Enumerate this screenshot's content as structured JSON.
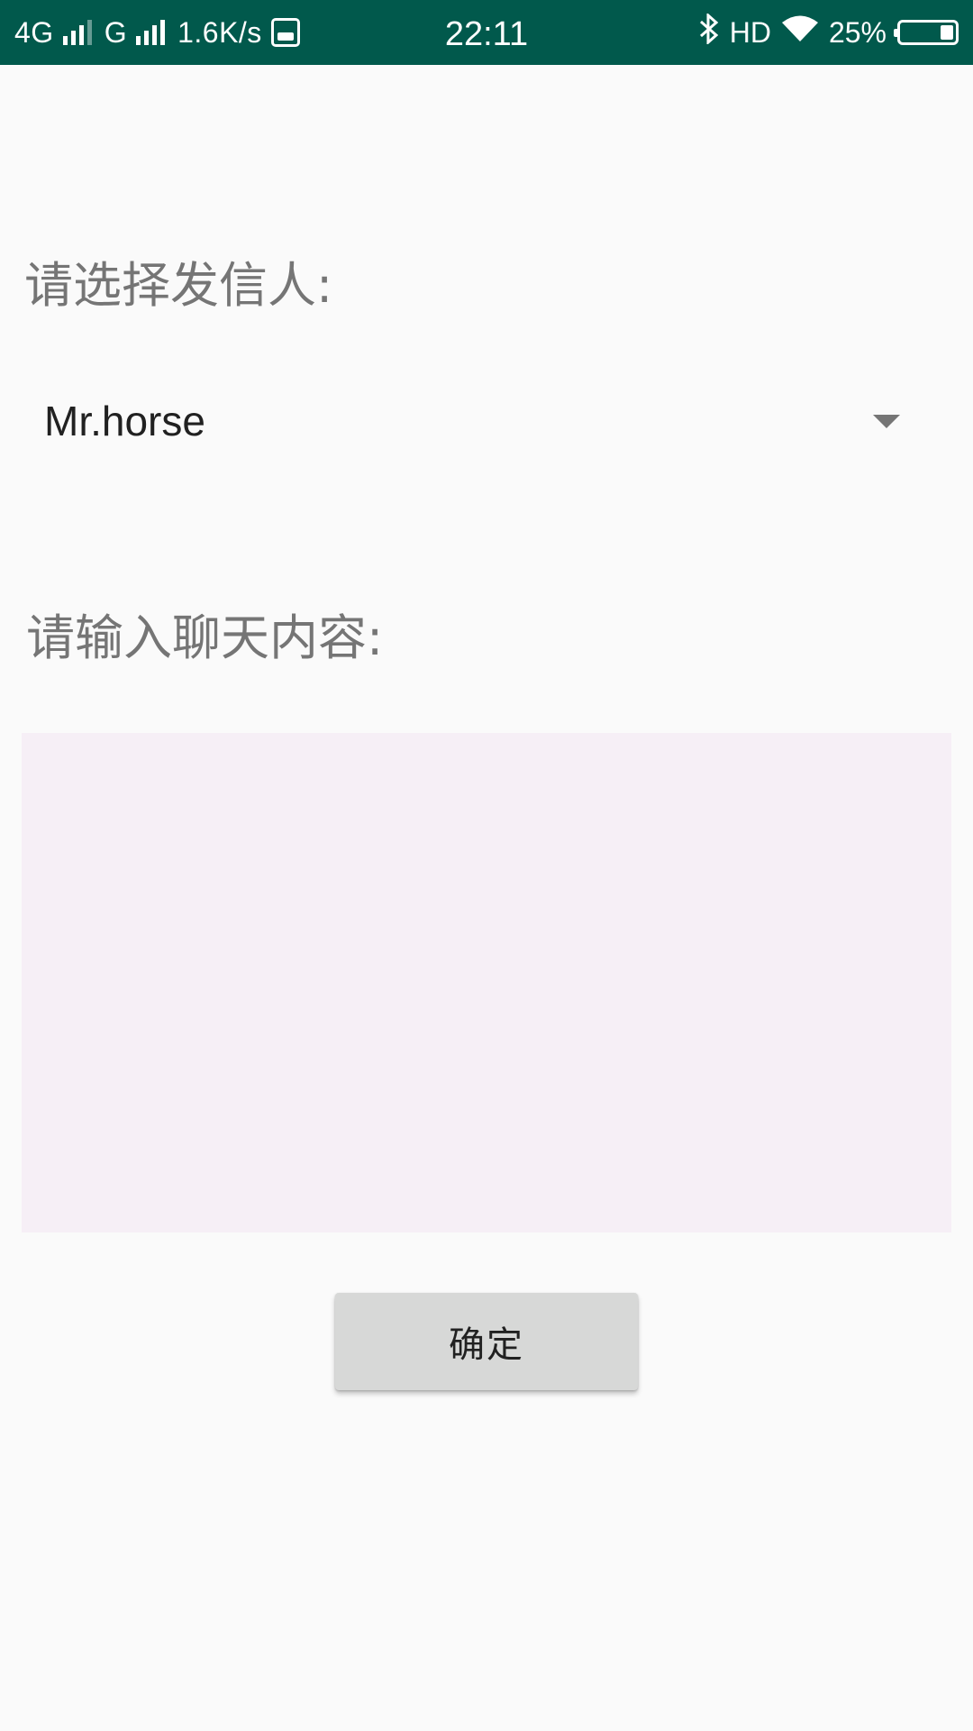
{
  "status_bar": {
    "network_1": "4G",
    "network_2": "G",
    "speed": "1.6K/s",
    "time": "22:11",
    "hd": "HD",
    "battery_percent": "25%",
    "battery_level": 0.25,
    "icons": [
      "signal-icon",
      "vivo-icon",
      "bluetooth-icon",
      "wifi-icon",
      "battery-icon"
    ],
    "background_color": "#01594c"
  },
  "form": {
    "sender_label": "请选择发信人:",
    "sender_selected": "Mr.horse",
    "content_label": "请输入聊天内容:",
    "content_value": "",
    "confirm_label": "确定"
  },
  "colors": {
    "input_background": "#f6eff6",
    "button_background": "#d7d8d7",
    "label_text": "#757575"
  }
}
